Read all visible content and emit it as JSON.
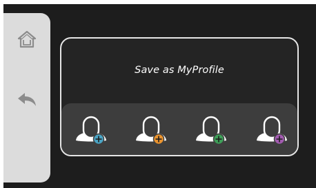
{
  "sidebar": {
    "home": {
      "icon": "home-icon"
    },
    "back": {
      "icon": "back-arrow-icon"
    }
  },
  "dialog": {
    "title": "Save as MyProfile"
  },
  "profiles": [
    {
      "icon": "user-add-icon",
      "badge_color": "#4aa3c3"
    },
    {
      "icon": "user-add-icon",
      "badge_color": "#e8922e"
    },
    {
      "icon": "user-add-icon",
      "badge_color": "#3e9e58"
    },
    {
      "icon": "user-add-icon",
      "badge_color": "#a25bb0"
    }
  ]
}
